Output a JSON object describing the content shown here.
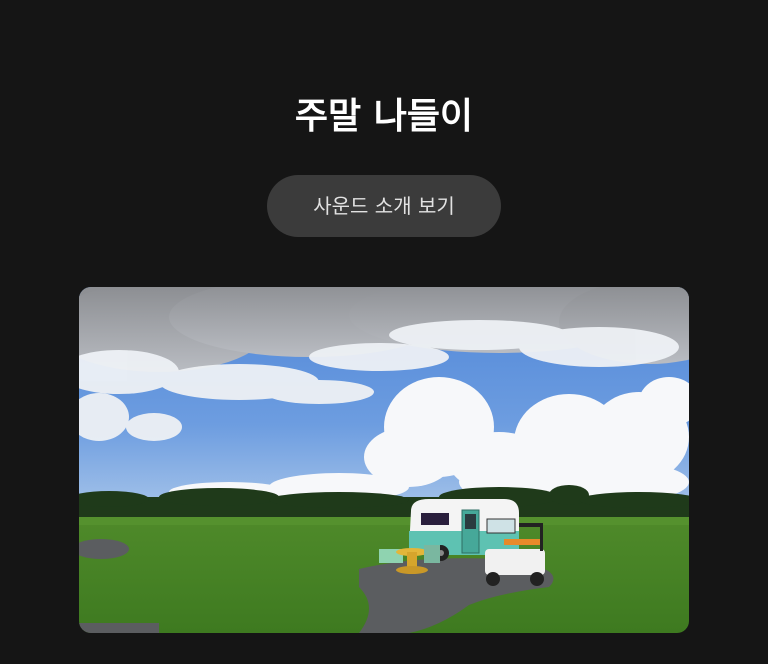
{
  "header": {
    "title": "주말 나들이"
  },
  "actions": {
    "sound_intro_label": "사운드 소개 보기"
  },
  "colors": {
    "background": "#151515",
    "button_bg": "#3b3b3b",
    "title_text": "#ffffff",
    "button_text": "#e2e2e2"
  }
}
